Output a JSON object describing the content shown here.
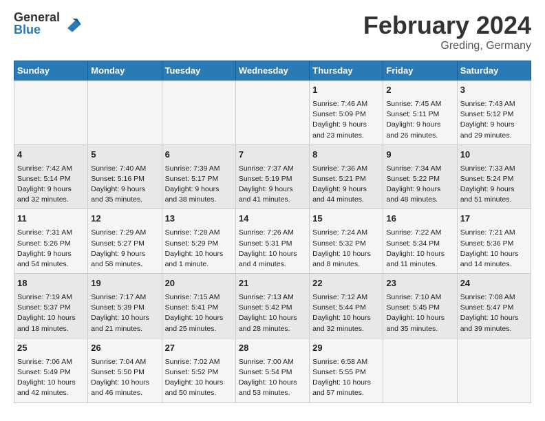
{
  "header": {
    "logo_general": "General",
    "logo_blue": "Blue",
    "month_title": "February 2024",
    "location": "Greding, Germany"
  },
  "columns": [
    "Sunday",
    "Monday",
    "Tuesday",
    "Wednesday",
    "Thursday",
    "Friday",
    "Saturday"
  ],
  "weeks": [
    {
      "cells": [
        {
          "day": "",
          "content": ""
        },
        {
          "day": "",
          "content": ""
        },
        {
          "day": "",
          "content": ""
        },
        {
          "day": "",
          "content": ""
        },
        {
          "day": "1",
          "content": "Sunrise: 7:46 AM\nSunset: 5:09 PM\nDaylight: 9 hours\nand 23 minutes."
        },
        {
          "day": "2",
          "content": "Sunrise: 7:45 AM\nSunset: 5:11 PM\nDaylight: 9 hours\nand 26 minutes."
        },
        {
          "day": "3",
          "content": "Sunrise: 7:43 AM\nSunset: 5:12 PM\nDaylight: 9 hours\nand 29 minutes."
        }
      ]
    },
    {
      "cells": [
        {
          "day": "4",
          "content": "Sunrise: 7:42 AM\nSunset: 5:14 PM\nDaylight: 9 hours\nand 32 minutes."
        },
        {
          "day": "5",
          "content": "Sunrise: 7:40 AM\nSunset: 5:16 PM\nDaylight: 9 hours\nand 35 minutes."
        },
        {
          "day": "6",
          "content": "Sunrise: 7:39 AM\nSunset: 5:17 PM\nDaylight: 9 hours\nand 38 minutes."
        },
        {
          "day": "7",
          "content": "Sunrise: 7:37 AM\nSunset: 5:19 PM\nDaylight: 9 hours\nand 41 minutes."
        },
        {
          "day": "8",
          "content": "Sunrise: 7:36 AM\nSunset: 5:21 PM\nDaylight: 9 hours\nand 44 minutes."
        },
        {
          "day": "9",
          "content": "Sunrise: 7:34 AM\nSunset: 5:22 PM\nDaylight: 9 hours\nand 48 minutes."
        },
        {
          "day": "10",
          "content": "Sunrise: 7:33 AM\nSunset: 5:24 PM\nDaylight: 9 hours\nand 51 minutes."
        }
      ]
    },
    {
      "cells": [
        {
          "day": "11",
          "content": "Sunrise: 7:31 AM\nSunset: 5:26 PM\nDaylight: 9 hours\nand 54 minutes."
        },
        {
          "day": "12",
          "content": "Sunrise: 7:29 AM\nSunset: 5:27 PM\nDaylight: 9 hours\nand 58 minutes."
        },
        {
          "day": "13",
          "content": "Sunrise: 7:28 AM\nSunset: 5:29 PM\nDaylight: 10 hours\nand 1 minute."
        },
        {
          "day": "14",
          "content": "Sunrise: 7:26 AM\nSunset: 5:31 PM\nDaylight: 10 hours\nand 4 minutes."
        },
        {
          "day": "15",
          "content": "Sunrise: 7:24 AM\nSunset: 5:32 PM\nDaylight: 10 hours\nand 8 minutes."
        },
        {
          "day": "16",
          "content": "Sunrise: 7:22 AM\nSunset: 5:34 PM\nDaylight: 10 hours\nand 11 minutes."
        },
        {
          "day": "17",
          "content": "Sunrise: 7:21 AM\nSunset: 5:36 PM\nDaylight: 10 hours\nand 14 minutes."
        }
      ]
    },
    {
      "cells": [
        {
          "day": "18",
          "content": "Sunrise: 7:19 AM\nSunset: 5:37 PM\nDaylight: 10 hours\nand 18 minutes."
        },
        {
          "day": "19",
          "content": "Sunrise: 7:17 AM\nSunset: 5:39 PM\nDaylight: 10 hours\nand 21 minutes."
        },
        {
          "day": "20",
          "content": "Sunrise: 7:15 AM\nSunset: 5:41 PM\nDaylight: 10 hours\nand 25 minutes."
        },
        {
          "day": "21",
          "content": "Sunrise: 7:13 AM\nSunset: 5:42 PM\nDaylight: 10 hours\nand 28 minutes."
        },
        {
          "day": "22",
          "content": "Sunrise: 7:12 AM\nSunset: 5:44 PM\nDaylight: 10 hours\nand 32 minutes."
        },
        {
          "day": "23",
          "content": "Sunrise: 7:10 AM\nSunset: 5:45 PM\nDaylight: 10 hours\nand 35 minutes."
        },
        {
          "day": "24",
          "content": "Sunrise: 7:08 AM\nSunset: 5:47 PM\nDaylight: 10 hours\nand 39 minutes."
        }
      ]
    },
    {
      "cells": [
        {
          "day": "25",
          "content": "Sunrise: 7:06 AM\nSunset: 5:49 PM\nDaylight: 10 hours\nand 42 minutes."
        },
        {
          "day": "26",
          "content": "Sunrise: 7:04 AM\nSunset: 5:50 PM\nDaylight: 10 hours\nand 46 minutes."
        },
        {
          "day": "27",
          "content": "Sunrise: 7:02 AM\nSunset: 5:52 PM\nDaylight: 10 hours\nand 50 minutes."
        },
        {
          "day": "28",
          "content": "Sunrise: 7:00 AM\nSunset: 5:54 PM\nDaylight: 10 hours\nand 53 minutes."
        },
        {
          "day": "29",
          "content": "Sunrise: 6:58 AM\nSunset: 5:55 PM\nDaylight: 10 hours\nand 57 minutes."
        },
        {
          "day": "",
          "content": ""
        },
        {
          "day": "",
          "content": ""
        }
      ]
    }
  ]
}
